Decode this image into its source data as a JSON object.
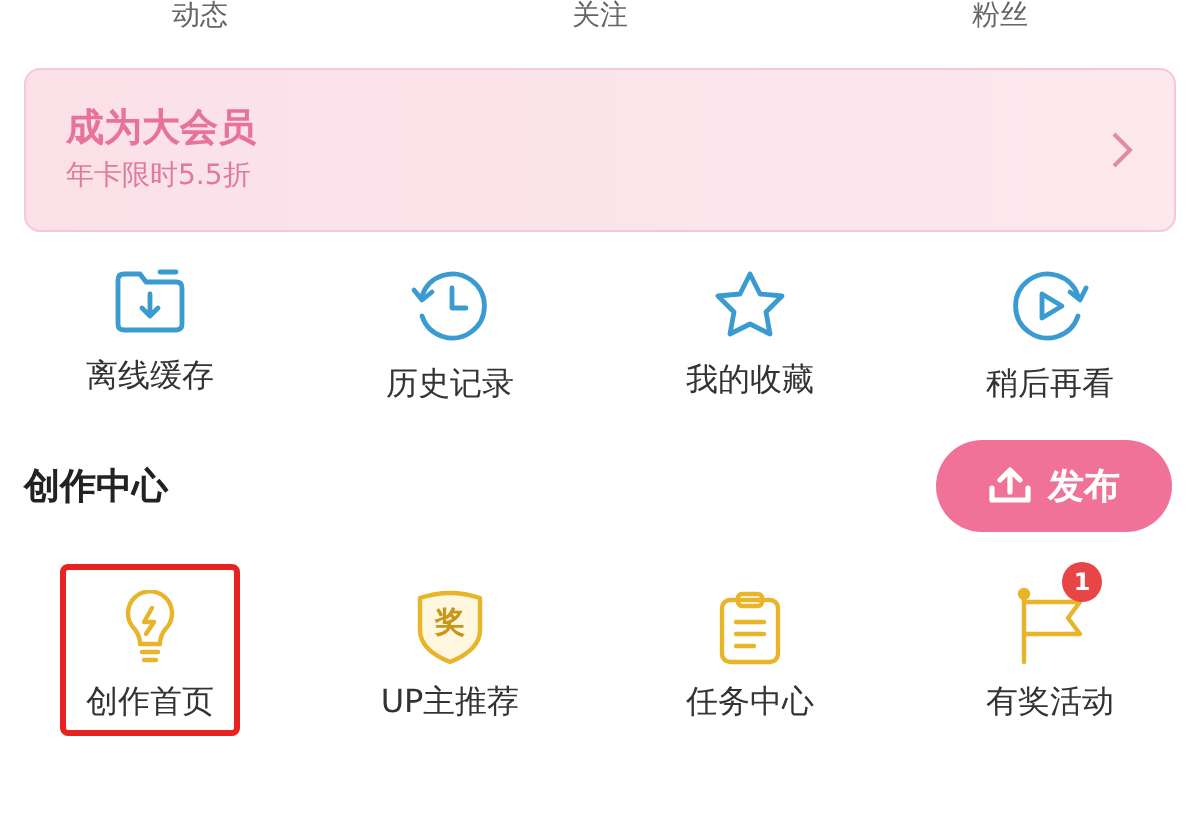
{
  "stats_tabs": [
    {
      "label": "动态"
    },
    {
      "label": "关注"
    },
    {
      "label": "粉丝"
    }
  ],
  "vip_banner": {
    "title": "成为大会员",
    "subtitle": "年卡限时5.5折"
  },
  "quick_actions": [
    {
      "label": "离线缓存",
      "kind": "download"
    },
    {
      "label": "历史记录",
      "kind": "history"
    },
    {
      "label": "我的收藏",
      "kind": "star"
    },
    {
      "label": "稍后再看",
      "kind": "later"
    }
  ],
  "creator_center": {
    "title": "创作中心",
    "publish_button": "发布",
    "items": [
      {
        "label": "创作首页",
        "kind": "bulb",
        "highlighted": true
      },
      {
        "label": "UP主推荐",
        "kind": "shield",
        "icon_text": "奖",
        "highlighted": false
      },
      {
        "label": "任务中心",
        "kind": "clipboard",
        "highlighted": false
      },
      {
        "label": "有奖活动",
        "kind": "flag",
        "badge": "1",
        "highlighted": false
      }
    ]
  }
}
